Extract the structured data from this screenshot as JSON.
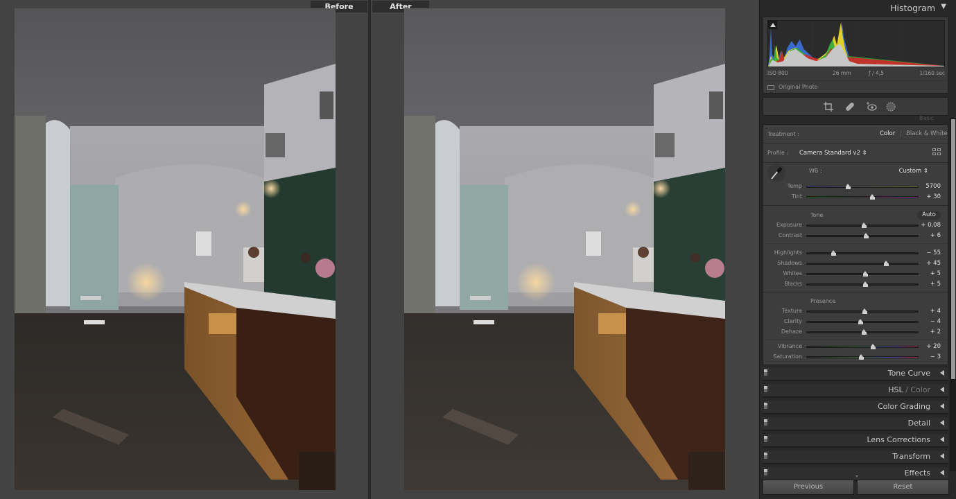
{
  "compare": {
    "before_label": "Before",
    "after_label": "After"
  },
  "histogram": {
    "title": "Histogram",
    "toggle_icon": "triangle-down-icon",
    "exif": {
      "iso": "ISO 800",
      "focal_length": "26 mm",
      "aperture": "ƒ / 4,5",
      "shutter": "1/160 sec"
    },
    "original_photo_label": "Original Photo"
  },
  "tools": [
    {
      "name": "crop-icon"
    },
    {
      "name": "healing-icon"
    },
    {
      "name": "red-eye-icon"
    },
    {
      "name": "masking-icon"
    }
  ],
  "basic": {
    "header": "Basic",
    "treatment_label": "Treatment :",
    "treatment_color": "Color",
    "treatment_bw": "Black & White",
    "profile_label": "Profile :",
    "profile_value": "Camera Standard v2 ⇕",
    "wb_label": "WB :",
    "wb_value": "Custom ⇕",
    "tone_label": "Tone",
    "auto_label": "Auto",
    "presence_label": "Presence",
    "sliders": [
      {
        "id": "temp",
        "label": "Temp",
        "value": "5700",
        "position": 0.37
      },
      {
        "id": "tint",
        "label": "Tint",
        "value": "+ 30",
        "position": 0.59
      },
      {
        "id": "exposure",
        "label": "Exposure",
        "value": "+ 0,08",
        "position": 0.51
      },
      {
        "id": "contrast",
        "label": "Contrast",
        "value": "+ 6",
        "position": 0.53
      },
      {
        "id": "highlights",
        "label": "Highlights",
        "value": "− 55",
        "position": 0.24
      },
      {
        "id": "shadows",
        "label": "Shadows",
        "value": "+ 45",
        "position": 0.71
      },
      {
        "id": "whites",
        "label": "Whites",
        "value": "+ 5",
        "position": 0.525
      },
      {
        "id": "blacks",
        "label": "Blacks",
        "value": "+ 5",
        "position": 0.525
      },
      {
        "id": "texture",
        "label": "Texture",
        "value": "+ 4",
        "position": 0.52
      },
      {
        "id": "clarity",
        "label": "Clarity",
        "value": "− 4",
        "position": 0.48
      },
      {
        "id": "dehaze",
        "label": "Dehaze",
        "value": "+ 2",
        "position": 0.51
      },
      {
        "id": "vibrance",
        "label": "Vibrance",
        "value": "+ 20",
        "position": 0.595
      },
      {
        "id": "saturation",
        "label": "Saturation",
        "value": "− 3",
        "position": 0.485
      }
    ]
  },
  "sections": [
    {
      "label": "Tone Curve"
    },
    {
      "label": "HSL",
      "suffix": " / Color"
    },
    {
      "label": "Color Grading"
    },
    {
      "label": "Detail"
    },
    {
      "label": "Lens Corrections"
    },
    {
      "label": "Transform"
    },
    {
      "label": "Effects"
    }
  ],
  "buttons": {
    "previous": "Previous",
    "reset": "Reset"
  }
}
